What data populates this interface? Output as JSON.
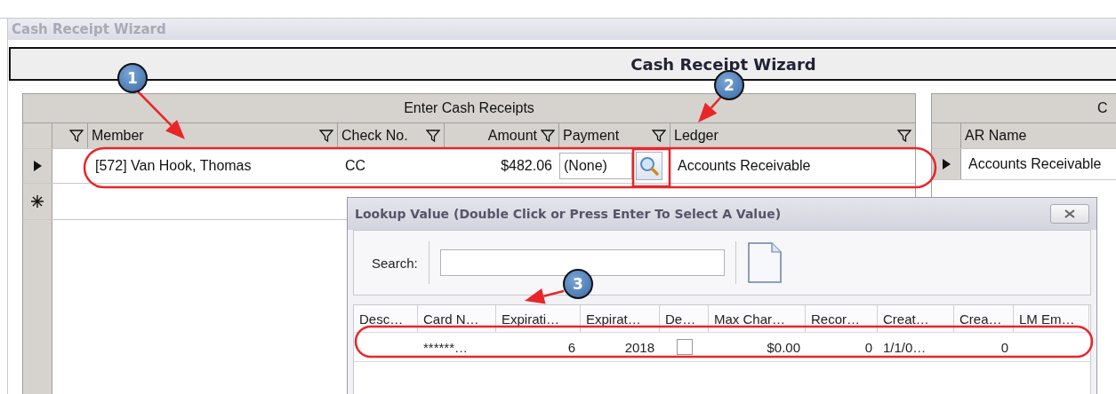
{
  "window": {
    "title": "Cash Receipt Wizard"
  },
  "header": {
    "title": "Cash Receipt Wizard"
  },
  "receipts_grid": {
    "title": "Enter Cash Receipts",
    "columns": [
      "Member",
      "Check No.",
      "Amount",
      "Payment",
      "Ledger"
    ],
    "rows": [
      {
        "selected": true,
        "member": "[572] Van Hook, Thomas",
        "check_no": "CC",
        "amount": "$482.06",
        "payment": "(None)",
        "ledger": "Accounts Receivable"
      }
    ]
  },
  "ar_grid": {
    "title": "C",
    "columns": [
      "AR Name"
    ],
    "rows": [
      {
        "selected": true,
        "ar_name": "Accounts Receivable"
      }
    ]
  },
  "lookup_dialog": {
    "title": "Lookup Value (Double Click or Press Enter To Select A Value)",
    "search": {
      "label": "Search:"
    },
    "columns": [
      "Desc…",
      "Card N…",
      "Expirati…",
      "Expirat…",
      "De…",
      "Max Char…",
      "Recor…",
      "Creat…",
      "Crea…",
      "LM Em…"
    ],
    "rows": [
      {
        "card_number": "******…",
        "exp_month": "6",
        "exp_year": "2018",
        "default": false,
        "max_charge": "$0.00",
        "record": "0",
        "created": "1/1/0…",
        "created_by": "0"
      }
    ]
  },
  "callouts": [
    "1",
    "2",
    "3"
  ]
}
